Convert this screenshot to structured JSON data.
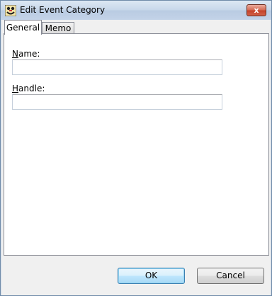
{
  "window": {
    "title": "Edit Event Category",
    "close_glyph": "x"
  },
  "tabs": [
    {
      "label": "General",
      "selected": true
    },
    {
      "label": "Memo",
      "selected": false
    }
  ],
  "fields": {
    "name": {
      "label_accel": "N",
      "label_rest": "ame:",
      "value": ""
    },
    "handle": {
      "label_accel": "H",
      "label_rest": "andle:",
      "value": ""
    }
  },
  "buttons": {
    "ok_label": "OK",
    "cancel_label": "Cancel"
  },
  "icons": {
    "app": "app-icon",
    "close": "close-icon"
  },
  "colors": {
    "titlebar": "#c7d7ea",
    "close_button": "#c4422a",
    "dialog_bg": "#f0f0f0",
    "default_button_border": "#3c7fb1"
  }
}
